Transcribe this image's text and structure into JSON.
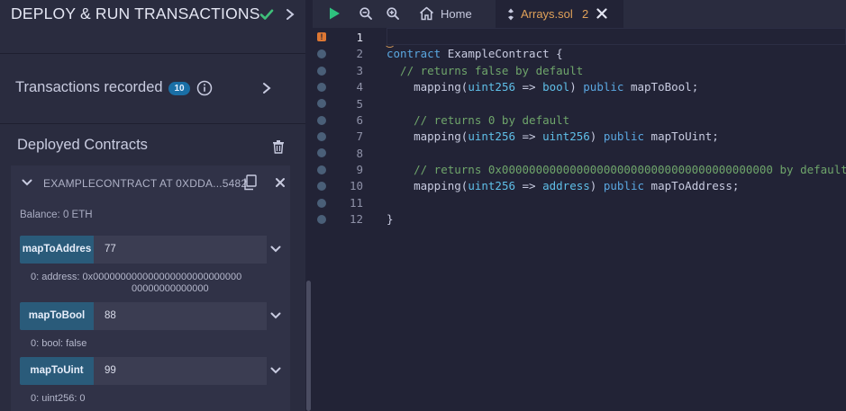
{
  "left_panel": {
    "title": "DEPLOY & RUN TRANSACTIONS",
    "transactions": {
      "label": "Transactions recorded",
      "count": "10"
    },
    "deployed": {
      "label": "Deployed Contracts",
      "contract_name": "EXAMPLECONTRACT AT 0XDDA...5482",
      "balance": "Balance: 0 ETH",
      "functions": [
        {
          "name": "mapToAddress",
          "display": "mapToAddres",
          "input": "77",
          "output_line1": "0:  address: 0x000000000000000000000000000",
          "output_line2": "00000000000000"
        },
        {
          "name": "mapToBool",
          "display": "mapToBool",
          "input": "88",
          "output_line1": "0: bool: false"
        },
        {
          "name": "mapToUint",
          "display": "mapToUint",
          "input": "99",
          "output_line1": "0: uint256: 0"
        }
      ]
    }
  },
  "topbar": {
    "tabs": [
      {
        "label": "Home"
      },
      {
        "label": "Arrays.sol",
        "count": "2"
      }
    ]
  },
  "editor": {
    "line_numbers": [
      "1",
      "2",
      "3",
      "4",
      "5",
      "6",
      "7",
      "8",
      "9",
      "10",
      "11",
      "12"
    ],
    "code": {
      "l2_kw": "contract",
      "l2_rest": " ExampleContract {",
      "l3": "  // returns false by default",
      "l4_a": "    mapping(",
      "l4_t1": "uint256",
      "l4_b": " => ",
      "l4_t2": "bool",
      "l4_c": ") ",
      "l4_kw": "public",
      "l4_d": " mapToBool;",
      "l6": "    // returns 0 by default",
      "l7_a": "    mapping(",
      "l7_t1": "uint256",
      "l7_b": " => ",
      "l7_t2": "uint256",
      "l7_c": ") ",
      "l7_kw": "public",
      "l7_d": " mapToUint;",
      "l9": "    // returns 0x0000000000000000000000000000000000000000 by default",
      "l10_a": "    mapping(",
      "l10_t1": "uint256",
      "l10_b": " => ",
      "l10_t2": "address",
      "l10_c": ") ",
      "l10_kw": "public",
      "l10_d": " mapToAddress;",
      "l12": "}"
    }
  },
  "colors": {
    "accent": "#2a5b7a",
    "warning": "#dd7733",
    "success": "#3fbf7a",
    "run": "#2ec27e"
  }
}
